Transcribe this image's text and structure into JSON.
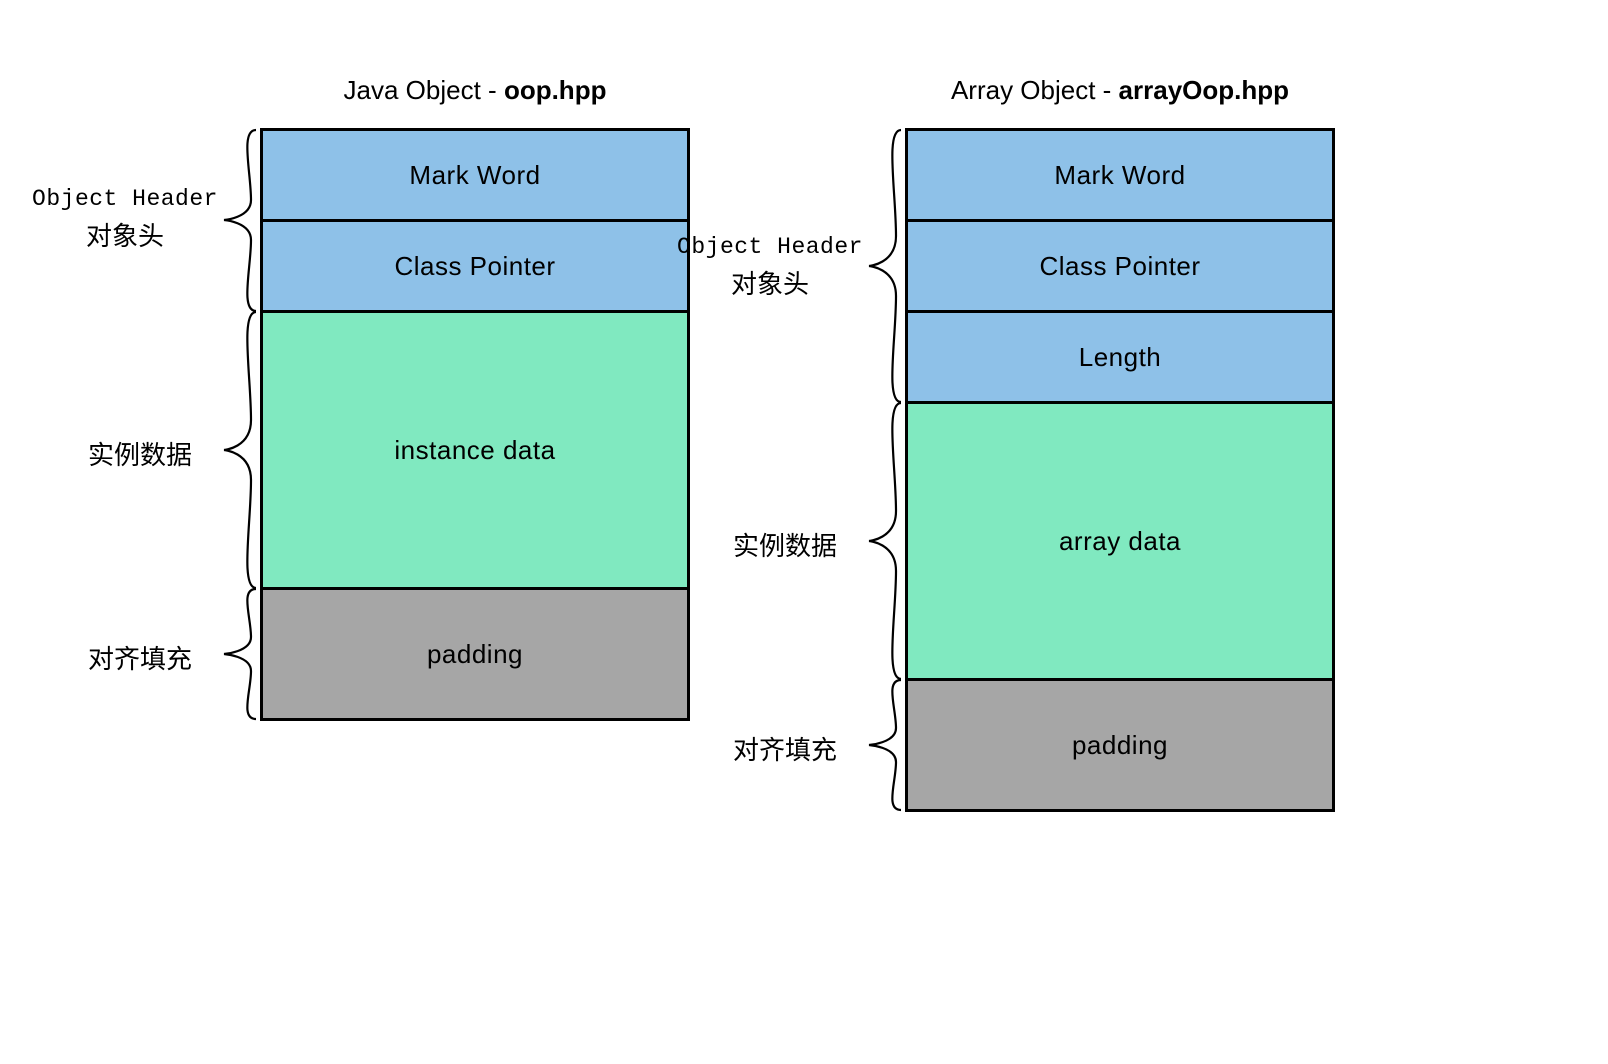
{
  "left": {
    "title_prefix": "Java Object - ",
    "title_bold": "oop.hpp",
    "sections": {
      "header_en": "Object Header",
      "header_cn": "对象头",
      "data_cn": "实例数据",
      "padding_cn": "对齐填充"
    },
    "blocks": {
      "mark_word": "Mark Word",
      "class_pointer": "Class Pointer",
      "instance_data": "instance data",
      "padding": "padding"
    }
  },
  "right": {
    "title_prefix": "Array Object - ",
    "title_bold": "arrayOop.hpp",
    "sections": {
      "header_en": "Object Header",
      "header_cn": "对象头",
      "data_cn": "实例数据",
      "padding_cn": "对齐填充"
    },
    "blocks": {
      "mark_word": "Mark Word",
      "class_pointer": "Class Pointer",
      "length": "Length",
      "array_data": "array data",
      "padding": "padding"
    }
  },
  "colors": {
    "header": "#8ec1e8",
    "data": "#80e9c0",
    "padding": "#a6a6a6",
    "border": "#000000"
  }
}
